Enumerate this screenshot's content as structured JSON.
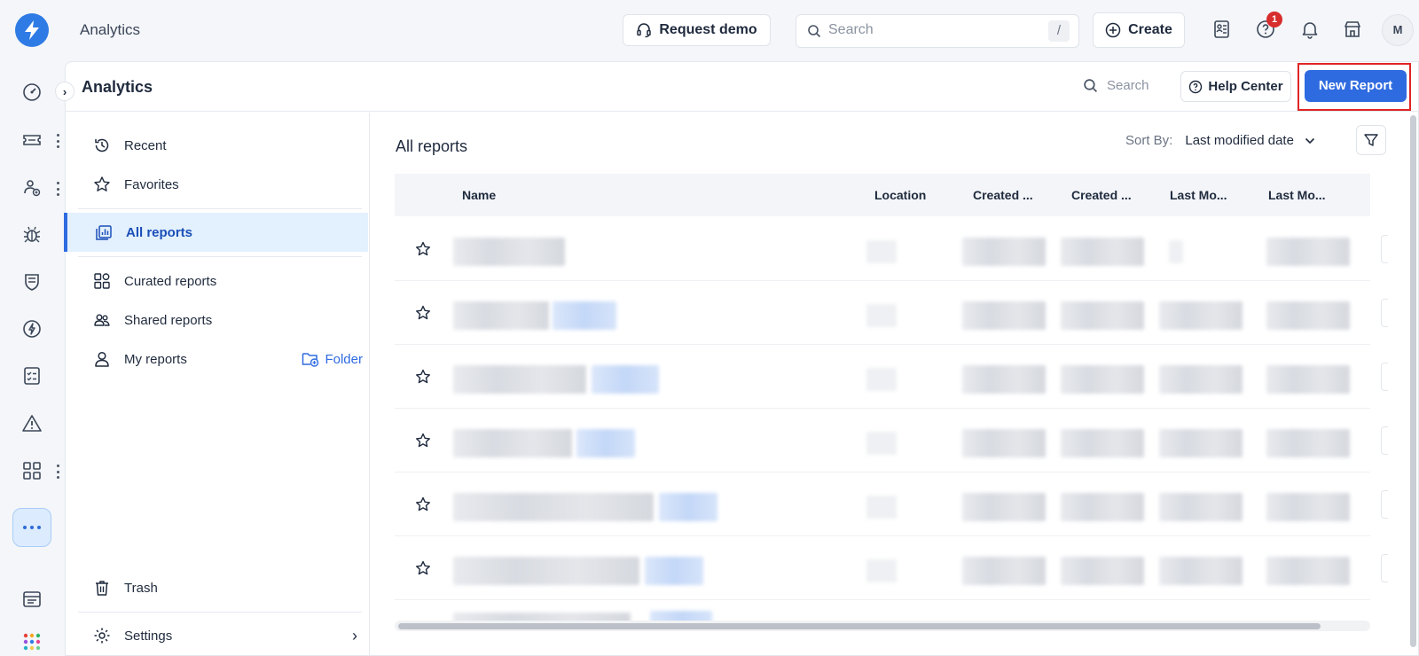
{
  "topbar": {
    "app_title": "Analytics",
    "request_demo": "Request demo",
    "search_placeholder": "Search",
    "search_shortcut": "/",
    "create": "Create",
    "help_badge": "1",
    "avatar_initial": "M",
    "brand_color": "#2f7be5"
  },
  "rail": {
    "icons": [
      "dashboard-icon",
      "tickets-icon",
      "contacts-icon",
      "bug-icon",
      "shield-icon",
      "lightning-icon",
      "checklist-icon",
      "alert-icon",
      "apps-icon",
      "more-icon",
      "billing-icon",
      "marketplace-icon"
    ]
  },
  "header": {
    "title": "Analytics",
    "search_label": "Search",
    "help_center": "Help Center",
    "new_report": "New Report",
    "accent_color": "#2f6be0"
  },
  "sidenav": {
    "recent": "Recent",
    "favorites": "Favorites",
    "all_reports": "All reports",
    "curated_reports": "Curated reports",
    "shared_reports": "Shared reports",
    "my_reports": "My reports",
    "folder": "Folder",
    "trash": "Trash",
    "settings": "Settings"
  },
  "reports": {
    "title": "All reports",
    "sort_label": "Sort By:",
    "sort_value": "Last modified date",
    "columns": [
      "Name",
      "Location",
      "Created ...",
      "Created ...",
      "Last Mo...",
      "Last Mo..."
    ],
    "row_count_visible": 6
  }
}
